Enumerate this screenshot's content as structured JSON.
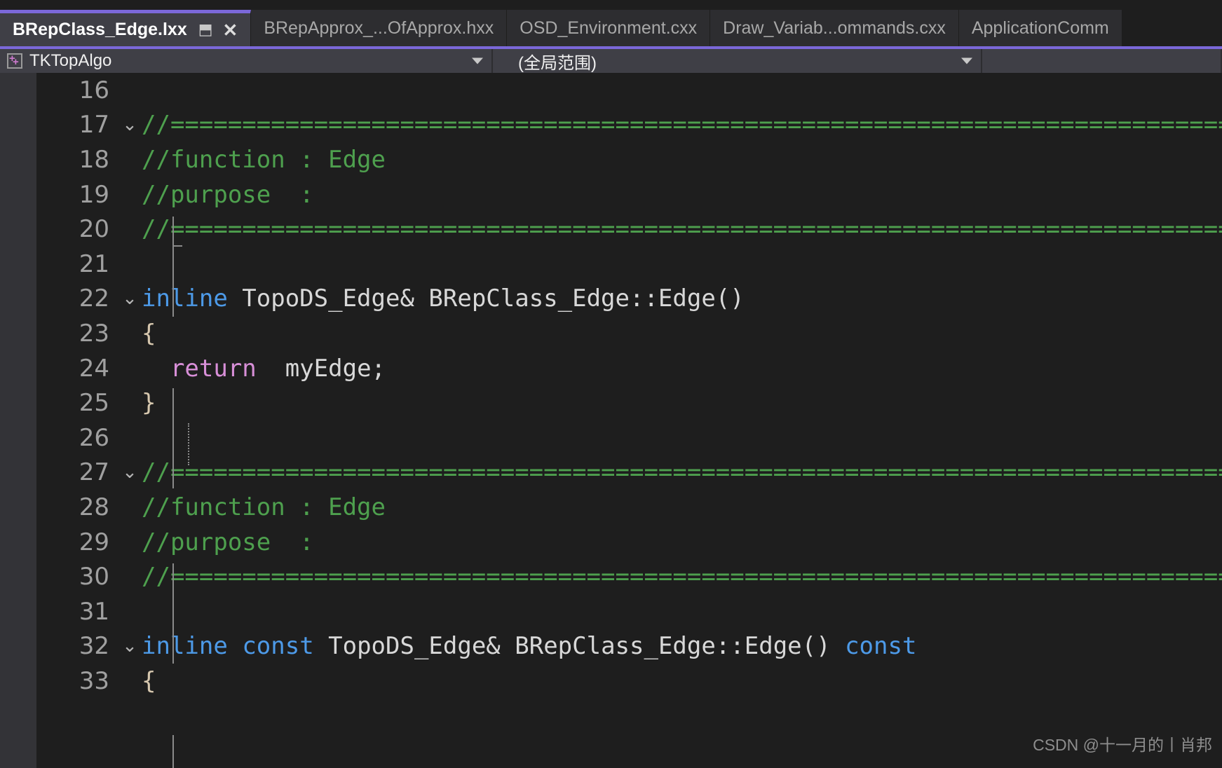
{
  "tabs": [
    {
      "label": "BRepClass_Edge.lxx",
      "active": true,
      "pin_icon": "pin-icon",
      "close_icon": "close-icon"
    },
    {
      "label": "BRepApprox_...OfApprox.hxx",
      "active": false
    },
    {
      "label": "OSD_Environment.cxx",
      "active": false
    },
    {
      "label": "Draw_Variab...ommands.cxx",
      "active": false
    },
    {
      "label": "ApplicationComm",
      "active": false
    }
  ],
  "navbar": {
    "project_icon": "cpp-project-icon",
    "project": "TKTopAlgo",
    "scope": "(全局范围)",
    "dropdown_icon": "chevron-down-icon"
  },
  "colors": {
    "accent_purple": "#7b68d9",
    "editor_bg": "#1e1e1e",
    "tab_active_bg": "#3f3f46",
    "tab_inactive_bg": "#2d2d30",
    "comment_green": "#4ea04e",
    "keyword_blue": "#4d9ae8",
    "control_pink": "#d88fd8",
    "plain_text": "#d8d8d8",
    "line_number": "#a0a0a0",
    "indicator_margin": "#333337"
  },
  "editor": {
    "first_visible_line": 16,
    "fold_icon": "chevron-down-icon",
    "lines": [
      {
        "n": 16,
        "fold": "",
        "tokens": []
      },
      {
        "n": 17,
        "fold": "v",
        "tokens": [
          {
            "t": "//===========================================================================",
            "c": "cmt"
          }
        ]
      },
      {
        "n": 18,
        "fold": "",
        "tokens": [
          {
            "t": "//function : Edge",
            "c": "cmt"
          }
        ]
      },
      {
        "n": 19,
        "fold": "",
        "tokens": [
          {
            "t": "//purpose  :",
            "c": "cmt"
          }
        ]
      },
      {
        "n": 20,
        "fold": "",
        "tokens": [
          {
            "t": "//===========================================================================",
            "c": "cmt"
          }
        ]
      },
      {
        "n": 21,
        "fold": "",
        "tokens": []
      },
      {
        "n": 22,
        "fold": "v",
        "tokens": [
          {
            "t": "inline",
            "c": "kw"
          },
          {
            "t": " TopoDS_Edge& BRepClass_Edge::Edge()",
            "c": "pln"
          }
        ]
      },
      {
        "n": 23,
        "fold": "",
        "tokens": [
          {
            "t": "{",
            "c": "brc"
          }
        ]
      },
      {
        "n": 24,
        "fold": "",
        "tokens": [
          {
            "t": "  ",
            "c": "pln"
          },
          {
            "t": "return",
            "c": "ctrl"
          },
          {
            "t": "  myEdge;",
            "c": "pln"
          }
        ]
      },
      {
        "n": 25,
        "fold": "",
        "tokens": [
          {
            "t": "}",
            "c": "brc"
          }
        ]
      },
      {
        "n": 26,
        "fold": "",
        "tokens": []
      },
      {
        "n": 27,
        "fold": "v",
        "tokens": [
          {
            "t": "//===========================================================================",
            "c": "cmt"
          }
        ]
      },
      {
        "n": 28,
        "fold": "",
        "tokens": [
          {
            "t": "//function : Edge",
            "c": "cmt"
          }
        ]
      },
      {
        "n": 29,
        "fold": "",
        "tokens": [
          {
            "t": "//purpose  :",
            "c": "cmt"
          }
        ]
      },
      {
        "n": 30,
        "fold": "",
        "tokens": [
          {
            "t": "//===========================================================================",
            "c": "cmt"
          }
        ]
      },
      {
        "n": 31,
        "fold": "",
        "tokens": []
      },
      {
        "n": 32,
        "fold": "v",
        "tokens": [
          {
            "t": "inline",
            "c": "kw"
          },
          {
            "t": " ",
            "c": "pln"
          },
          {
            "t": "const",
            "c": "kw"
          },
          {
            "t": " TopoDS_Edge& BRepClass_Edge::Edge() ",
            "c": "pln"
          },
          {
            "t": "const",
            "c": "kw"
          }
        ]
      },
      {
        "n": 33,
        "fold": "",
        "tokens": [
          {
            "t": "{",
            "c": "brc"
          }
        ]
      }
    ]
  },
  "watermark": "CSDN @十一月的丨肖邦"
}
